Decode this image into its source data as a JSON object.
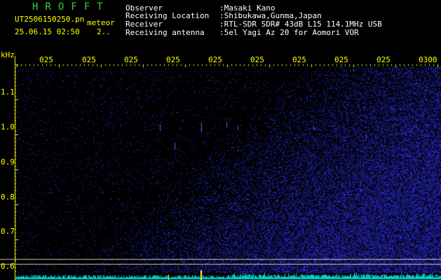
{
  "header": {
    "title": "HROFFT",
    "filename": "UT2506150250.pn",
    "meteor_label": "meteor",
    "datetime": "25.06.15 02:50",
    "count": "2..",
    "fields": [
      {
        "label": "Observer",
        "value": ":Masaki Kano"
      },
      {
        "label": "Receiving Location",
        "value": ":Shibukawa,Gunma,Japan"
      },
      {
        "label": "Receiver",
        "value": ":RTL-SDR SDR# 43dB L15 114.1MHz USB"
      },
      {
        "label": "Receiving antenna",
        "value": ":5el Yagi Az 20 for Aomori VOR"
      }
    ]
  },
  "axes": {
    "y_unit": "kHz",
    "y_ticks": [
      "1.1",
      "1.0",
      "0.9",
      "0.8",
      "0.7",
      "0.6"
    ],
    "x_ticks": [
      "025",
      "025",
      "025",
      "025",
      "025",
      "025",
      "025",
      "025",
      "025",
      "0300"
    ]
  },
  "colors": {
    "axis": "#ffff00",
    "title": "#33d633",
    "text": "#ffffff",
    "noise": "#2a2aff",
    "baseline": "#00cccc"
  }
}
